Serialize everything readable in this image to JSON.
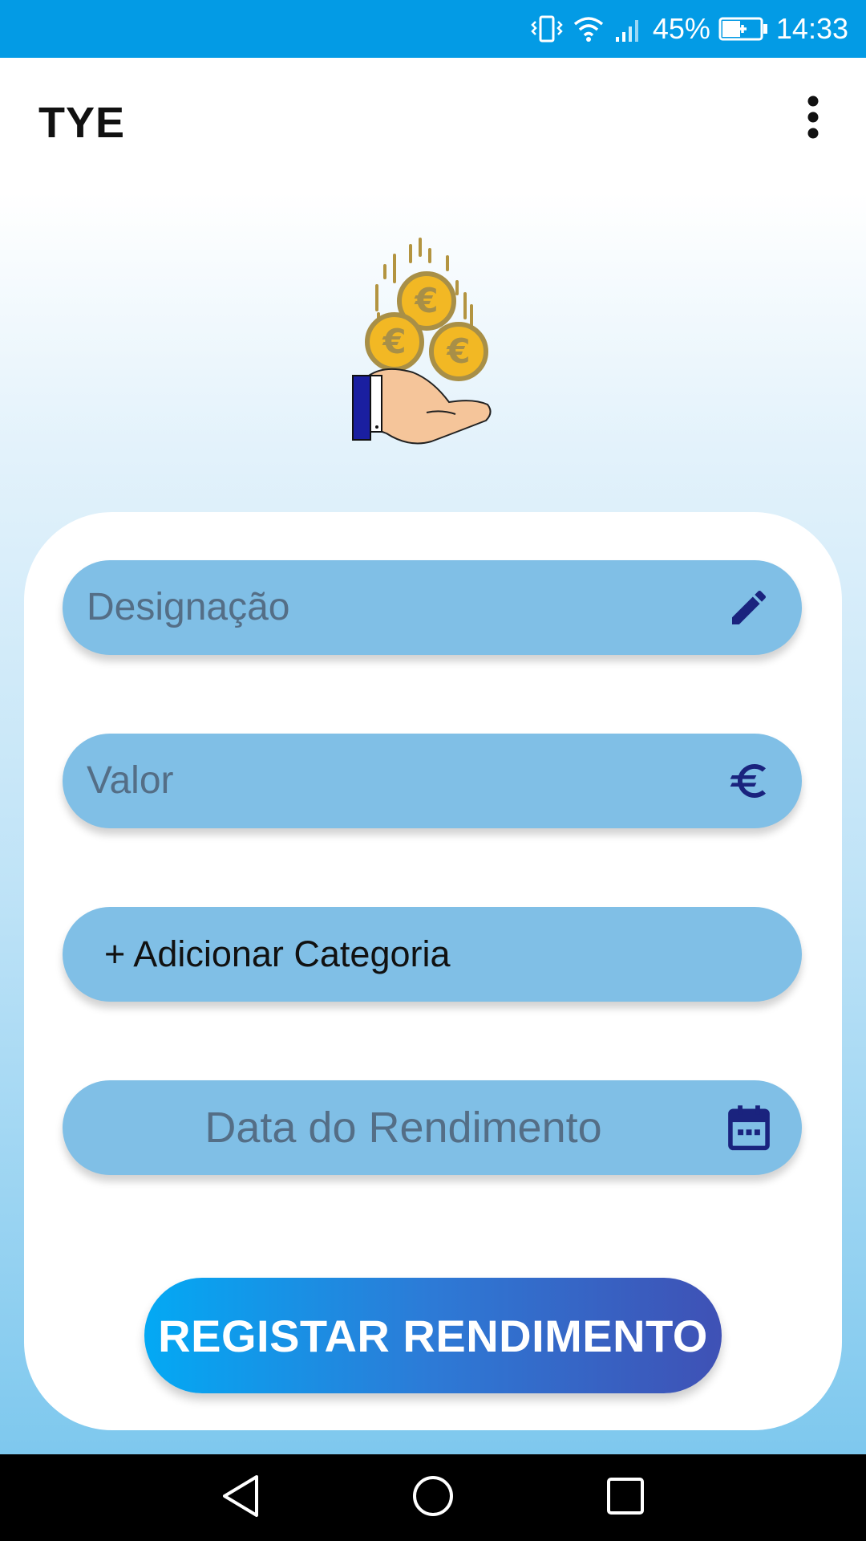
{
  "status_bar": {
    "battery_percent": "45%",
    "time": "14:33",
    "background_color": "#039be5",
    "icons": [
      "vibrate-icon",
      "wifi-icon",
      "signal-icon",
      "battery-charging-icon"
    ]
  },
  "app_bar": {
    "title": "TYE",
    "menu_icon": "more-vert-icon"
  },
  "hero": {
    "icon": "hand-with-euro-coins-icon"
  },
  "form": {
    "designation": {
      "placeholder": "Designação",
      "icon": "pencil-icon"
    },
    "value": {
      "placeholder": "Valor",
      "icon": "euro-icon"
    },
    "category": {
      "label": "+ Adicionar Categoria"
    },
    "date": {
      "placeholder": "Data do Rendimento",
      "icon": "calendar-icon"
    },
    "submit_label": "REGISTAR RENDIMENTO"
  },
  "colors": {
    "field_background": "#80bfe6",
    "icon_color": "#1a237e",
    "button_gradient_start": "#03a9f4",
    "button_gradient_end": "#3f51b5"
  },
  "nav_bar": {
    "buttons": [
      "back-icon",
      "home-icon",
      "recents-icon"
    ]
  }
}
